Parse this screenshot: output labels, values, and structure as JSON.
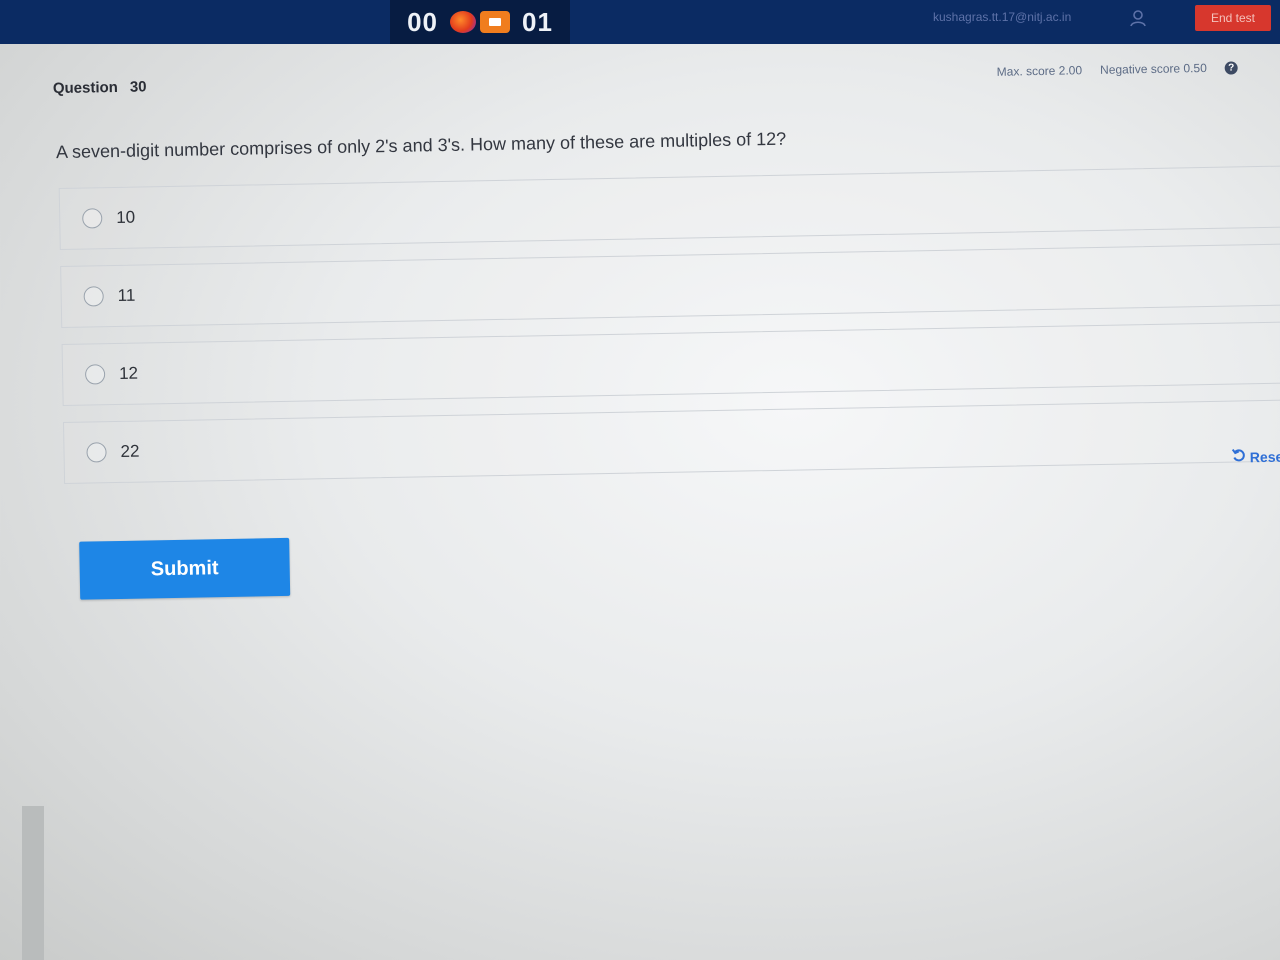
{
  "header": {
    "timer_left": "00",
    "timer_right": "01",
    "user_email": "kushagras.tt.17@nitj.ac.in",
    "end_test_label": "End test"
  },
  "question": {
    "label": "Question",
    "number": "30",
    "max_score": "Max. score 2.00",
    "negative_score": "Negative score 0.50",
    "help_glyph": "?",
    "text": "A seven-digit number comprises of only 2's and 3's. How many of these are multiples of 12?",
    "options": [
      "10",
      "11",
      "12",
      "22"
    ]
  },
  "actions": {
    "reset_label": "Rese",
    "submit_label": "Submit"
  },
  "colors": {
    "header_bg": "#0b2b63",
    "submit_bg": "#1e86e6",
    "end_test_bg": "#d7372d",
    "reset_text": "#2f6fd6"
  },
  "icons": {
    "camera_overlay": "browser-icon",
    "video": "video-camera-icon",
    "user": "user-icon",
    "help": "help-icon",
    "reset": "reset-icon"
  }
}
